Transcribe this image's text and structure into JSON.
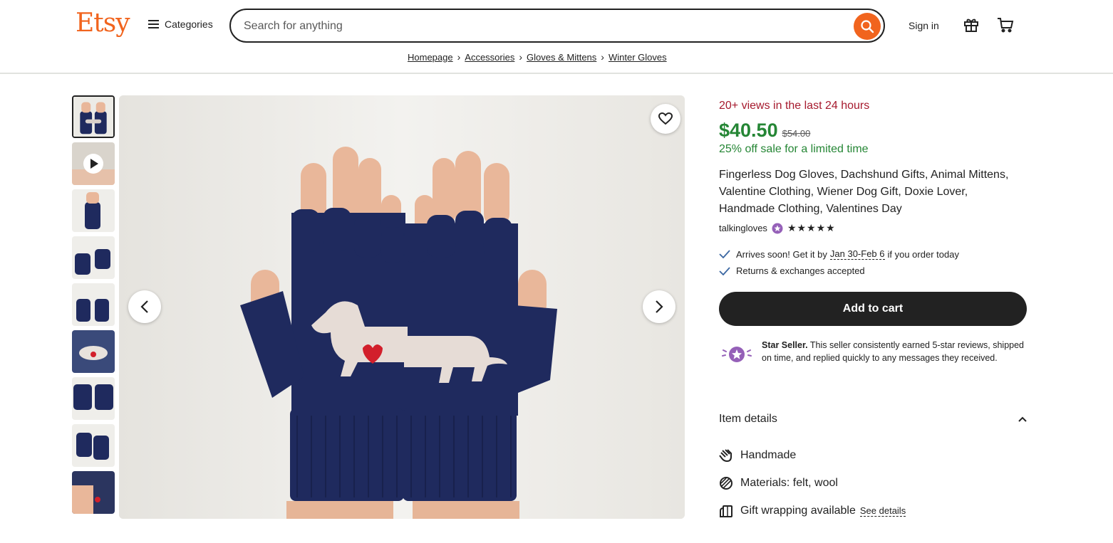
{
  "header": {
    "logo": "Etsy",
    "categories_label": "Categories",
    "search_placeholder": "Search for anything",
    "signin_label": "Sign in"
  },
  "breadcrumb": [
    "Homepage",
    "Accessories",
    "Gloves & Mittens",
    "Winter Gloves"
  ],
  "listing": {
    "views": "20+ views in the last 24 hours",
    "price": "$40.50",
    "old_price": "$54.00",
    "sale": "25% off sale for a limited time",
    "title": "Fingerless Dog Gloves, Dachshund Gifts, Animal Mittens, Valentine Clothing, Wiener Dog Gift, Doxie Lover, Handmade Clothing, Valentines Day",
    "shop_name": "talkingloves",
    "rating_stars": "★★★★★",
    "arrives_prefix": "Arrives soon! Get it by",
    "arrives_date": "Jan 30-Feb 6",
    "arrives_suffix": "if you order today",
    "returns": "Returns & exchanges accepted",
    "add_to_cart": "Add to cart",
    "star_seller_title": "Star Seller.",
    "star_seller_text": "This seller consistently earned 5-star reviews, shipped on time, and replied quickly to any messages they received.",
    "item_details_label": "Item details",
    "details": {
      "handmade": "Handmade",
      "materials": "Materials: felt, wool",
      "gift_wrap": "Gift wrapping available",
      "see_details": "See details"
    }
  },
  "colors": {
    "brand": "#f1641e",
    "sale_green": "#258635",
    "views_red": "#a61a2e",
    "glove_navy": "#1f2a5e"
  }
}
